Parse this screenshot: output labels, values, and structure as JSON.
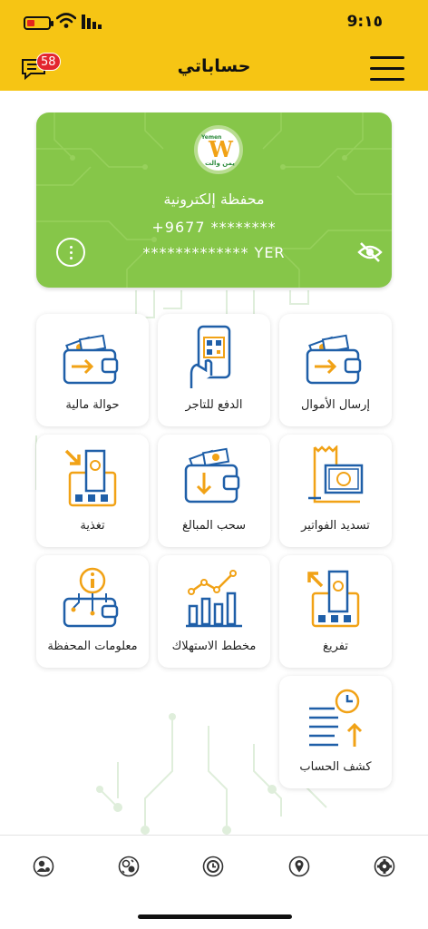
{
  "status_bar": {
    "time": "9:١٥"
  },
  "header": {
    "title": "حساباتي",
    "notification_count": "58"
  },
  "card": {
    "wallet_type": "محفظة إلكترونية",
    "phone": "+9677 ********",
    "balance": "************* YER",
    "logo_top": "Yemen",
    "logo_bottom": "يمن والت"
  },
  "services": [
    {
      "label": "إرسال الأموال",
      "icon": "send-money-icon"
    },
    {
      "label": "الدفع للتاجر",
      "icon": "merchant-pay-icon"
    },
    {
      "label": "حوالة مالية",
      "icon": "money-transfer-icon"
    },
    {
      "label": "تسديد الفواتير",
      "icon": "bill-payment-icon"
    },
    {
      "label": "سحب المبالغ",
      "icon": "withdraw-icon"
    },
    {
      "label": "تغذية",
      "icon": "top-up-icon"
    },
    {
      "label": "تفريغ",
      "icon": "unload-icon"
    },
    {
      "label": "مخطط الاستهلاك",
      "icon": "usage-chart-icon"
    },
    {
      "label": "معلومات المحفظة",
      "icon": "wallet-info-icon"
    },
    {
      "label": "كشف الحساب",
      "icon": "account-statement-icon"
    }
  ],
  "bottom_nav": [
    {
      "icon": "settings-icon"
    },
    {
      "icon": "location-icon"
    },
    {
      "icon": "history-icon"
    },
    {
      "icon": "currency-exchange-icon"
    },
    {
      "icon": "profile-icon"
    }
  ],
  "colors": {
    "brand_yellow": "#f6c514",
    "card_green": "#86c649",
    "icon_blue": "#1f5fa8",
    "icon_orange": "#f1a216"
  }
}
